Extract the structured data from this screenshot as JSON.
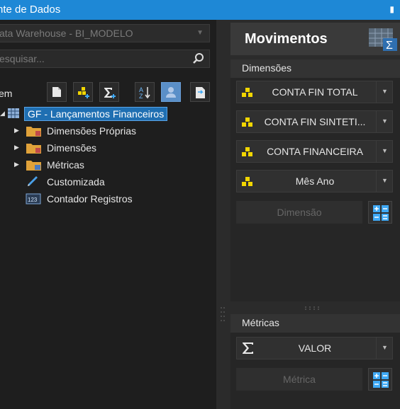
{
  "window": {
    "title": "nte de Dados",
    "pin_glyph": "ⵌ"
  },
  "source": {
    "selected": "ata Warehouse - BI_MODELO"
  },
  "search": {
    "placeholder": "esquisar..."
  },
  "toolbar": {
    "label": "em",
    "buttons": [
      "new-item-icon",
      "add-dimension-icon",
      "add-metric-icon",
      "sort-az-icon",
      "user-icon",
      "export-icon"
    ]
  },
  "tree": {
    "root": {
      "label": "GF - Lançamentos Financeiros",
      "selected": true
    },
    "children": [
      {
        "label": "Dimensões Próprias",
        "icon": "folder-dimension-icon",
        "expandable": true
      },
      {
        "label": "Dimensões",
        "icon": "folder-dimension-icon",
        "expandable": true
      },
      {
        "label": "Métricas",
        "icon": "folder-metric-icon",
        "expandable": true
      },
      {
        "label": "Customizada",
        "icon": "pencil-icon",
        "expandable": false
      },
      {
        "label": "Contador Registros",
        "icon": "counter-123-icon",
        "expandable": false
      }
    ]
  },
  "movimentos": {
    "title": "Movimentos",
    "dimensions_header": "Dimensões",
    "dimensions": [
      "CONTA FIN TOTAL",
      "CONTA FIN SINTETI...",
      "CONTA FINANCEIRA",
      "Mês Ano"
    ],
    "dimension_placeholder": "Dimensão",
    "metrics_header": "Métricas",
    "metrics": [
      "VALOR"
    ],
    "metric_placeholder": "Métrica"
  },
  "colors": {
    "titlebar": "#1e88d6",
    "selection": "#1f6fb2",
    "dimension_icon": "#f2d600"
  }
}
